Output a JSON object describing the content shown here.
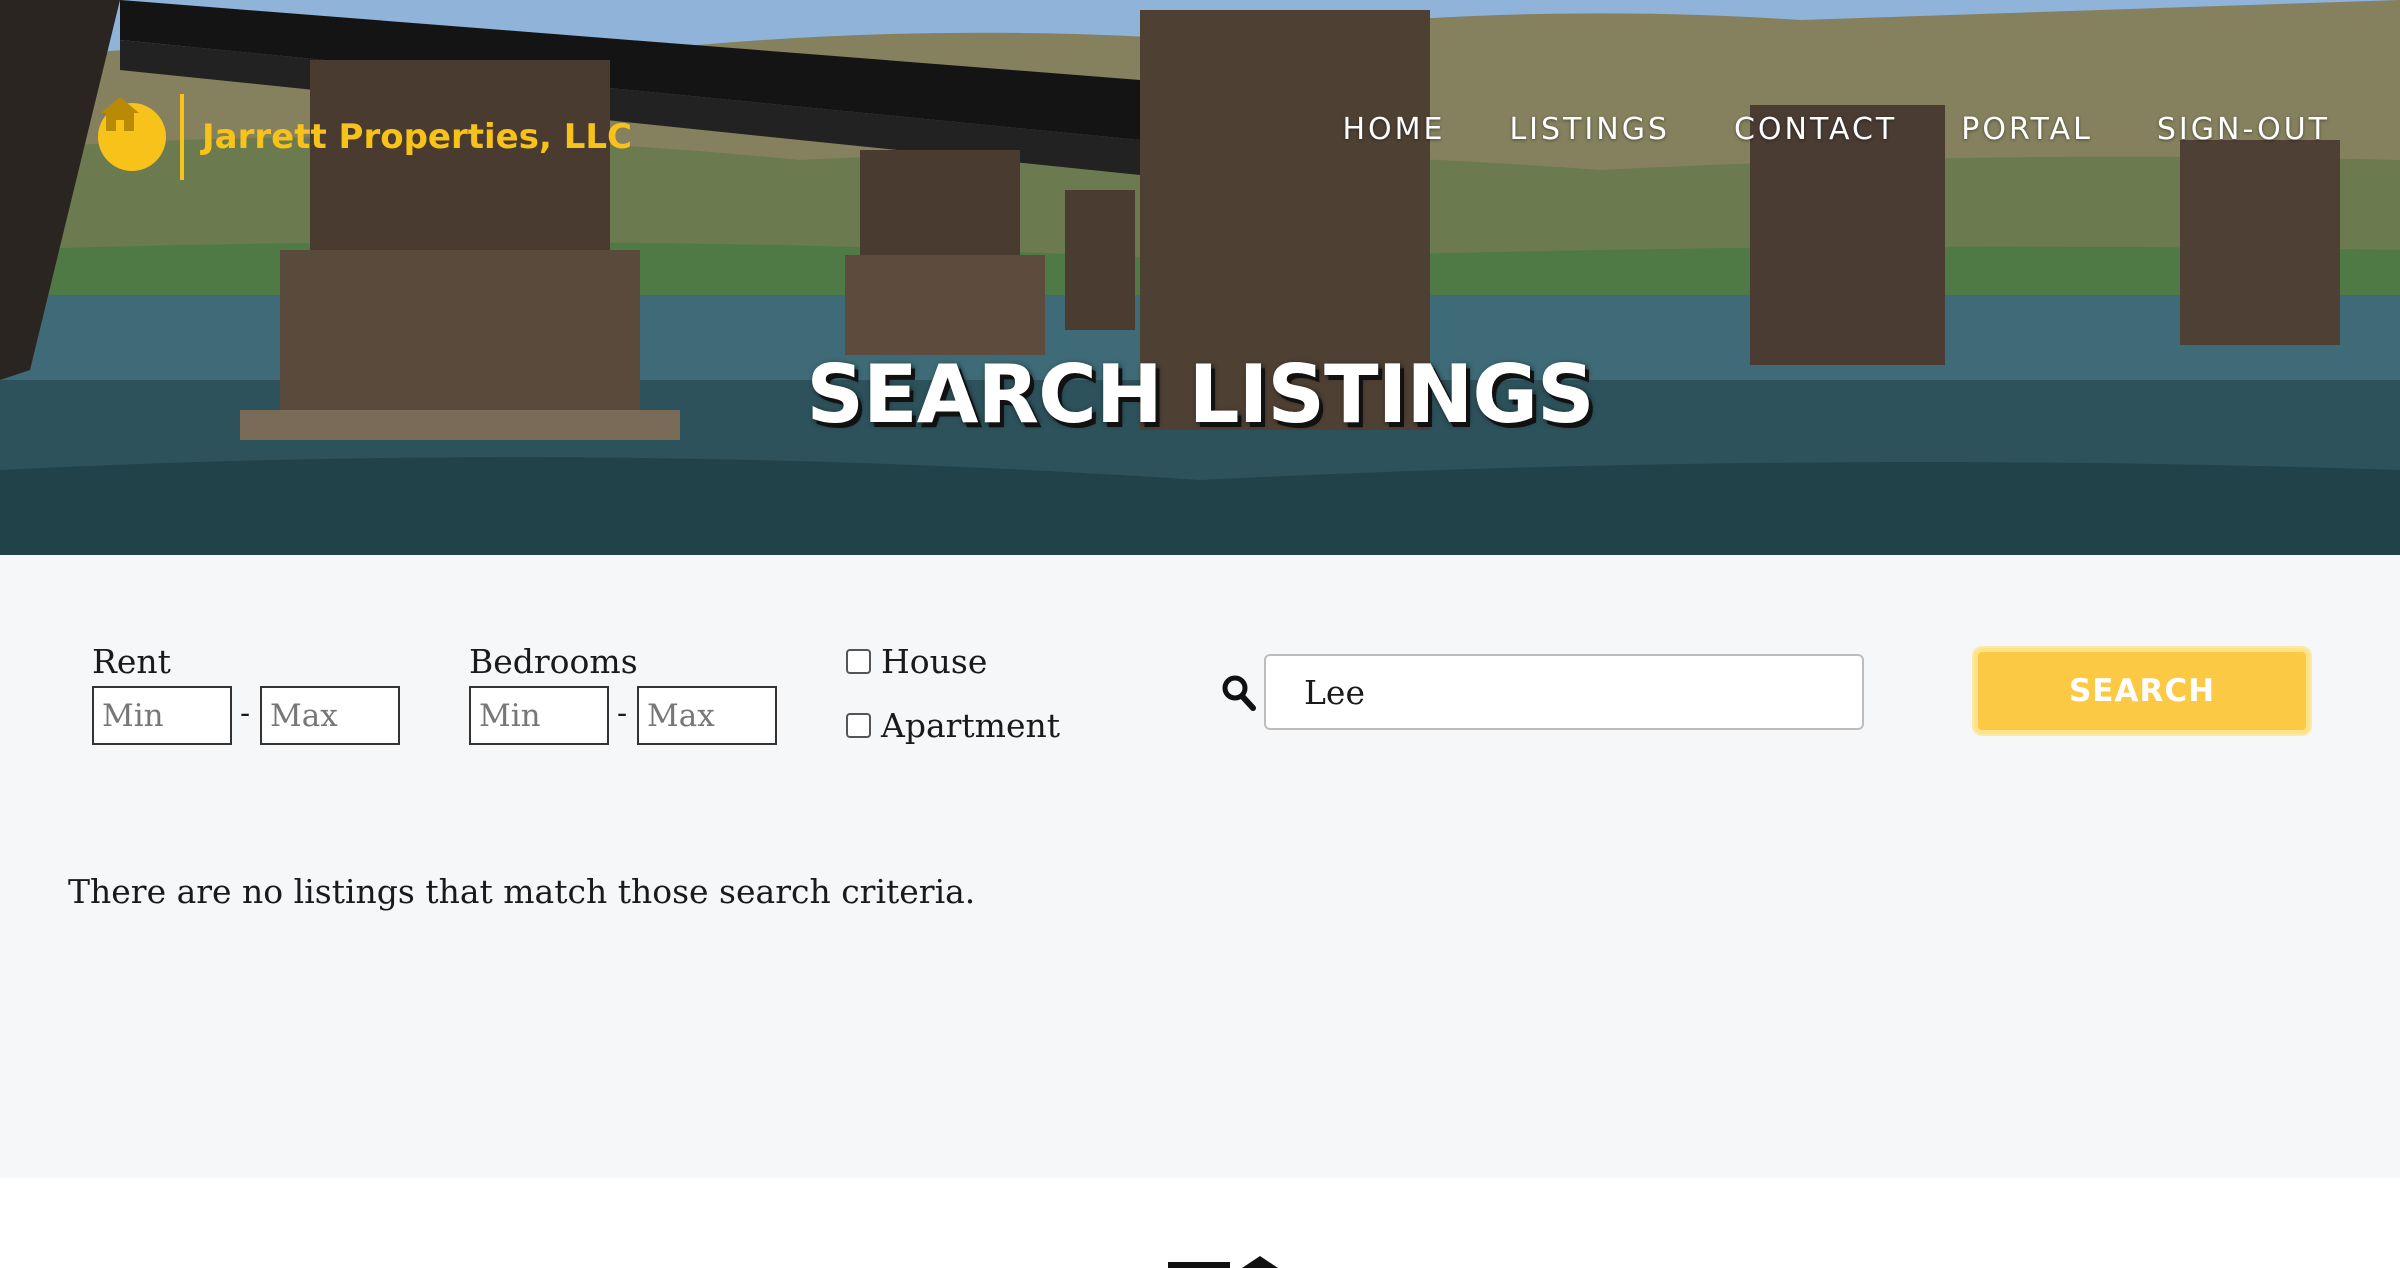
{
  "brand": {
    "name": "Jarrett Properties, LLC",
    "logo_icon": "house-icon",
    "accent_color": "#f7c21a"
  },
  "nav": {
    "items": [
      {
        "label": "HOME"
      },
      {
        "label": "LISTINGS"
      },
      {
        "label": "CONTACT"
      },
      {
        "label": "PORTAL"
      },
      {
        "label": "SIGN-OUT"
      }
    ]
  },
  "hero": {
    "title": "SEARCH LISTINGS"
  },
  "filters": {
    "rent": {
      "label": "Rent",
      "min_placeholder": "Min",
      "max_placeholder": "Max",
      "separator": "-"
    },
    "bedrooms": {
      "label": "Bedrooms",
      "min_placeholder": "Min",
      "max_placeholder": "Max",
      "separator": "-"
    },
    "types": [
      {
        "label": "House",
        "checked": false
      },
      {
        "label": "Apartment",
        "checked": false
      }
    ],
    "search": {
      "icon": "search-icon",
      "value": "Lee"
    },
    "search_button_label": "SEARCH",
    "button_color": "#fbc943"
  },
  "results": {
    "empty_message": "There are no listings that match those search criteria."
  }
}
